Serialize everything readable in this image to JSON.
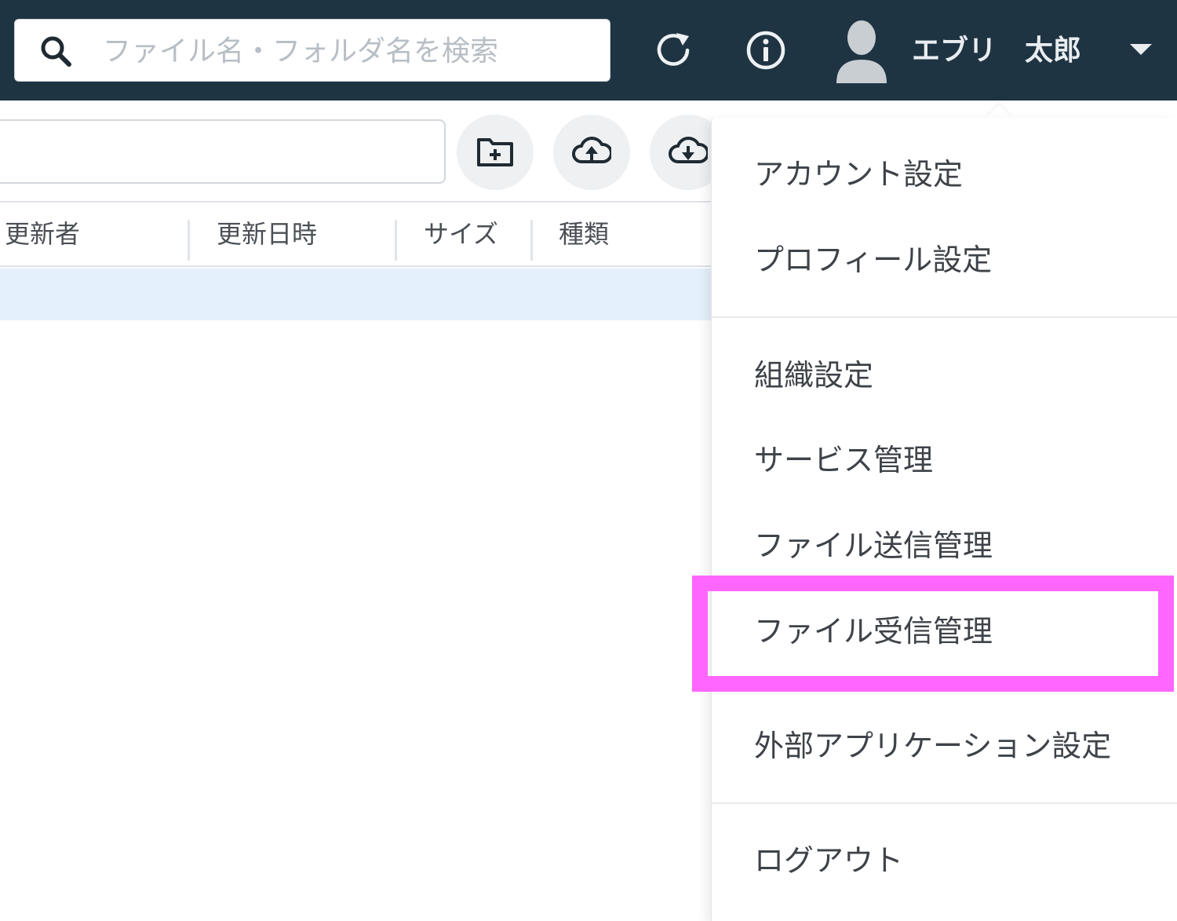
{
  "header": {
    "search_placeholder": "ファイル名・フォルダ名を検索",
    "user_name": "エブリ　太郎",
    "icons": [
      "search-icon",
      "refresh-icon",
      "info-icon",
      "avatar-icon",
      "caret-down-icon"
    ]
  },
  "toolbar": {
    "icons": [
      "new-folder-icon",
      "upload-icon",
      "download-icon"
    ]
  },
  "table": {
    "columns": [
      "更新者",
      "更新日時",
      "サイズ",
      "種類"
    ]
  },
  "menu": {
    "items": [
      "アカウント設定",
      "プロフィール設定",
      "組織設定",
      "サービス管理",
      "ファイル送信管理",
      "ファイル受信管理",
      "外部アプリケーション設定",
      "ログアウト"
    ],
    "highlighted_item": "ファイル受信管理",
    "highlight_color": "#ff66ff"
  },
  "colors": {
    "topbar": "#1f3443",
    "selected_row": "#e4f1fc"
  }
}
